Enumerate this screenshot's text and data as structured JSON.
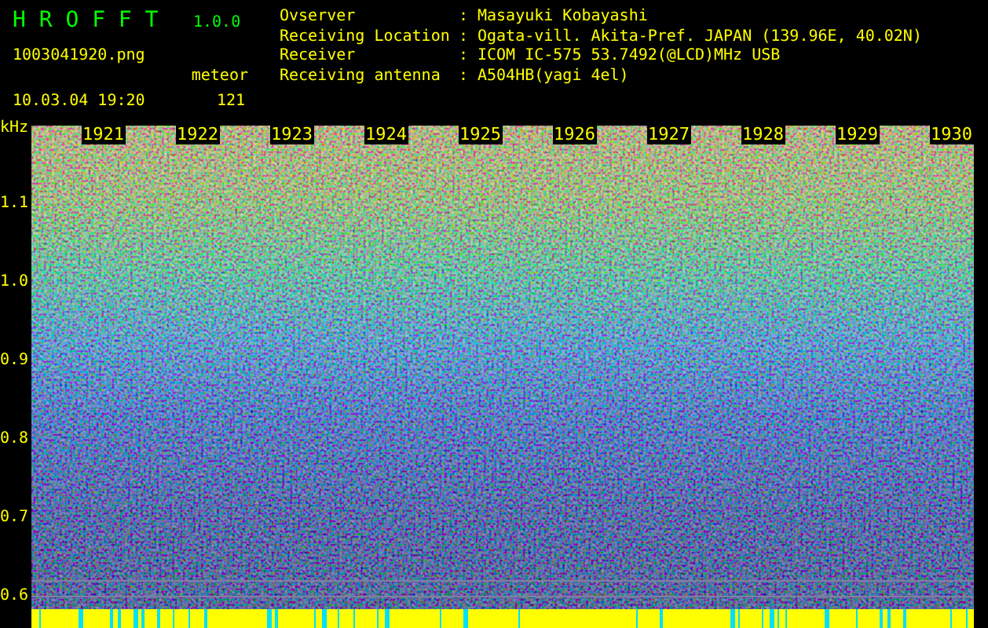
{
  "header": {
    "app_title": "H R O F F T",
    "version": "1.0.0",
    "filename": "1003041920.png",
    "datetime": "10.03.04 19:20",
    "mode": "meteor",
    "count": "121",
    "info": [
      {
        "label": "Ovserver",
        "separator": ":",
        "value": "Masayuki Kobayashi"
      },
      {
        "label": "Receiving Location",
        "separator": ":",
        "value": "Ogata-vill. Akita-Pref. JAPAN (139.96E, 40.02N)"
      },
      {
        "label": "Receiver",
        "separator": ":",
        "value": "ICOM IC-575 53.7492(@LCD)MHz USB"
      },
      {
        "label": "Receiving antenna",
        "separator": ":",
        "value": "A504HB(yagi 4el)"
      }
    ]
  },
  "spectrogram": {
    "unit": "kHz",
    "y_labels": [
      "1.1",
      "1.0",
      "0.9",
      "0.8",
      "0.7",
      "0.6"
    ],
    "time_labels": [
      "1921",
      "1922",
      "1923",
      "1924",
      "1925",
      "1926",
      "1927",
      "1928",
      "1929",
      "1930"
    ]
  }
}
